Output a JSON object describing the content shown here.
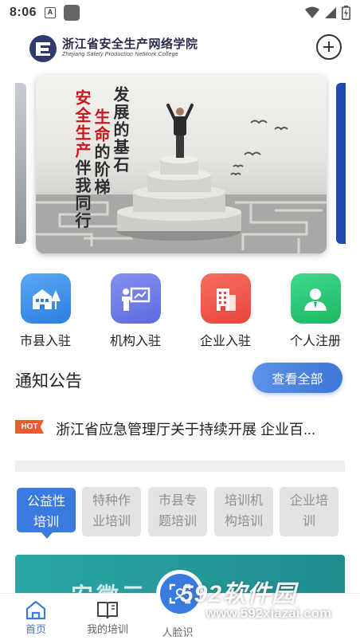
{
  "status_bar": {
    "time": "8:06",
    "a_label": "A"
  },
  "header": {
    "logo_cn": "浙江省安全生产网络学院",
    "logo_en": "Zhejiang Safety Production Network College"
  },
  "banner": {
    "line1": "发展的基石",
    "line2": "生命的阶梯",
    "line3": "安全生产伴我同行"
  },
  "entries": [
    {
      "label": "市县入驻",
      "icon": "building-tree-icon",
      "color": "#3a8de8"
    },
    {
      "label": "机构入驻",
      "icon": "presenter-board-icon",
      "color": "#6b7be6"
    },
    {
      "label": "企业入驻",
      "icon": "office-building-icon",
      "color": "#f0594a"
    },
    {
      "label": "个人注册",
      "icon": "person-icon",
      "color": "#2fc274"
    }
  ],
  "notice": {
    "title": "通知公告",
    "view_all": "查看全部",
    "hot_badge": "HOT",
    "item_text": "浙江省应急管理厅关于持续开展 企业百..."
  },
  "training_tabs": [
    {
      "line1": "公益性",
      "line2": "培训",
      "active": true
    },
    {
      "line1": "特种作",
      "line2": "业培训",
      "active": false
    },
    {
      "line1": "市县专",
      "line2": "题培训",
      "active": false
    },
    {
      "line1": "培训机",
      "line2": "构培训",
      "active": false
    },
    {
      "line1": "企业培",
      "line2": "训",
      "active": false
    }
  ],
  "card_preview": {
    "text": "安徽三"
  },
  "bottom_nav": [
    {
      "label": "首页",
      "icon": "home-icon",
      "active": true
    },
    {
      "label": "我的培训",
      "icon": "book-icon",
      "active": false
    },
    {
      "label": "人脸识",
      "icon": "face-scan-icon",
      "active": false
    }
  ],
  "watermark": {
    "brand": "592软件园",
    "url": "www.592xiazai.com"
  },
  "colors": {
    "accent": "#3a7be0",
    "hot": "#f0592c",
    "tab_inactive": "#e3e3e3"
  }
}
